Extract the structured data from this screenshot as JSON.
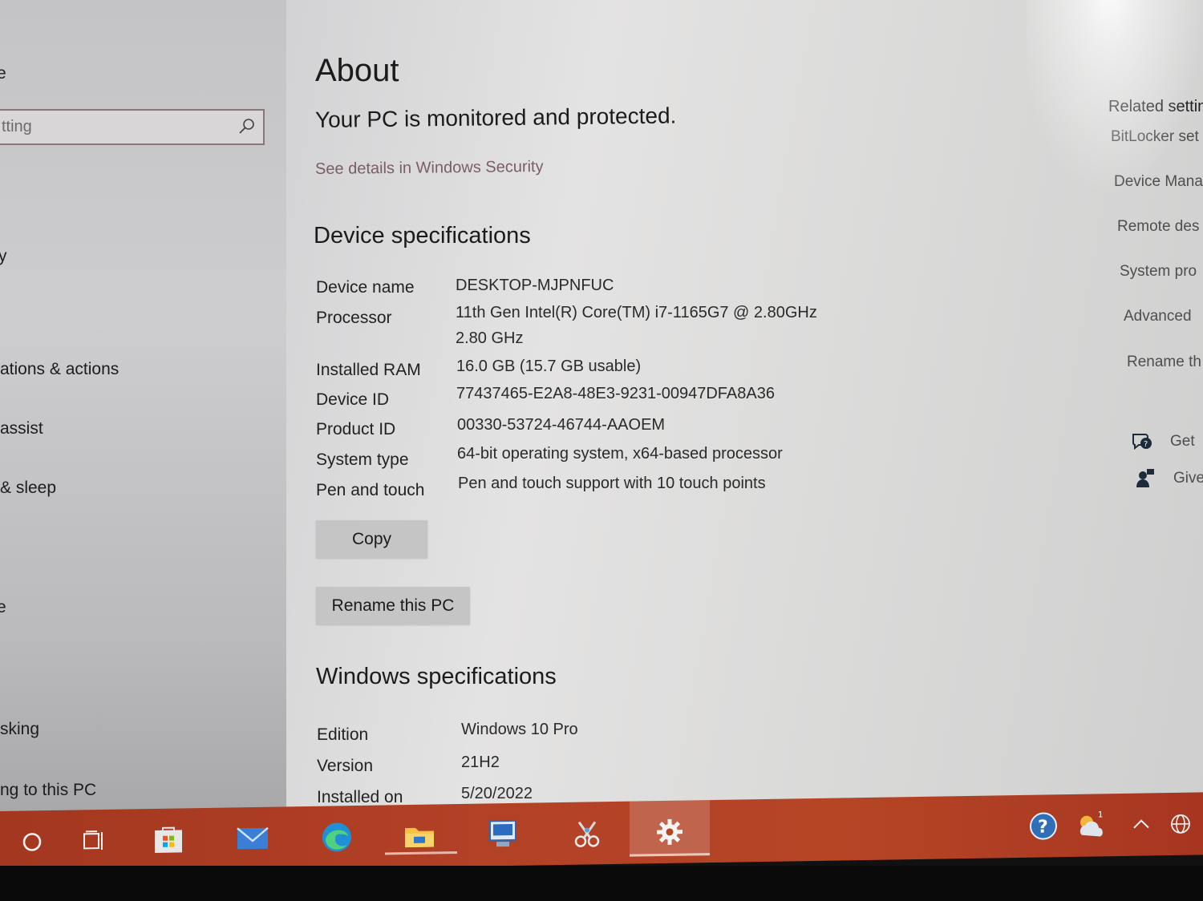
{
  "sidebar": {
    "frag_top": "e",
    "search_placeholder": "tting",
    "items": [
      {
        "label": "y"
      },
      {
        "label": "ations & actions"
      },
      {
        "label": "assist"
      },
      {
        "label": "& sleep"
      },
      {
        "label": "e"
      },
      {
        "label": "sking"
      },
      {
        "label": "ng to this PC"
      }
    ]
  },
  "about": {
    "title": "About",
    "protected": "Your PC is monitored and protected.",
    "security_link": "See details in Windows Security"
  },
  "device_specs": {
    "heading": "Device specifications",
    "rows": [
      {
        "label": "Device name",
        "value": "DESKTOP-MJPNFUC"
      },
      {
        "label": "Processor",
        "value": "11th Gen Intel(R) Core(TM) i7-1165G7 @ 2.80GHz",
        "value2": "2.80 GHz"
      },
      {
        "label": "Installed RAM",
        "value": "16.0 GB (15.7 GB usable)"
      },
      {
        "label": "Device ID",
        "value": "77437465-E2A8-48E3-9231-00947DFA8A36"
      },
      {
        "label": "Product ID",
        "value": "00330-53724-46744-AAOEM"
      },
      {
        "label": "System type",
        "value": "64-bit operating system, x64-based processor"
      },
      {
        "label": "Pen and touch",
        "value": "Pen and touch support with 10 touch points"
      }
    ],
    "copy_label": "Copy",
    "rename_label": "Rename this PC"
  },
  "windows_specs": {
    "heading": "Windows specifications",
    "rows": [
      {
        "label": "Edition",
        "value": "Windows 10 Pro"
      },
      {
        "label": "Version",
        "value": "21H2"
      },
      {
        "label": "Installed on",
        "value": "5/20/2022"
      }
    ]
  },
  "related": {
    "heading": "Related settin",
    "links": [
      "BitLocker set",
      "Device Mana",
      "Remote des",
      "System pro",
      "Advanced",
      "Rename th"
    ],
    "help": [
      "Get",
      "Give"
    ]
  },
  "taskbar": {
    "icons": [
      "cortana-icon",
      "task-view-icon",
      "store-icon",
      "mail-icon",
      "edge-icon",
      "file-explorer-icon",
      "remote-desktop-icon",
      "snipping-tool-icon",
      "settings-icon"
    ],
    "tray": [
      "help-icon",
      "weather-icon",
      "chevron-up-icon",
      "globe-icon"
    ],
    "weather_badge": "1",
    "accent": "#b24126"
  }
}
